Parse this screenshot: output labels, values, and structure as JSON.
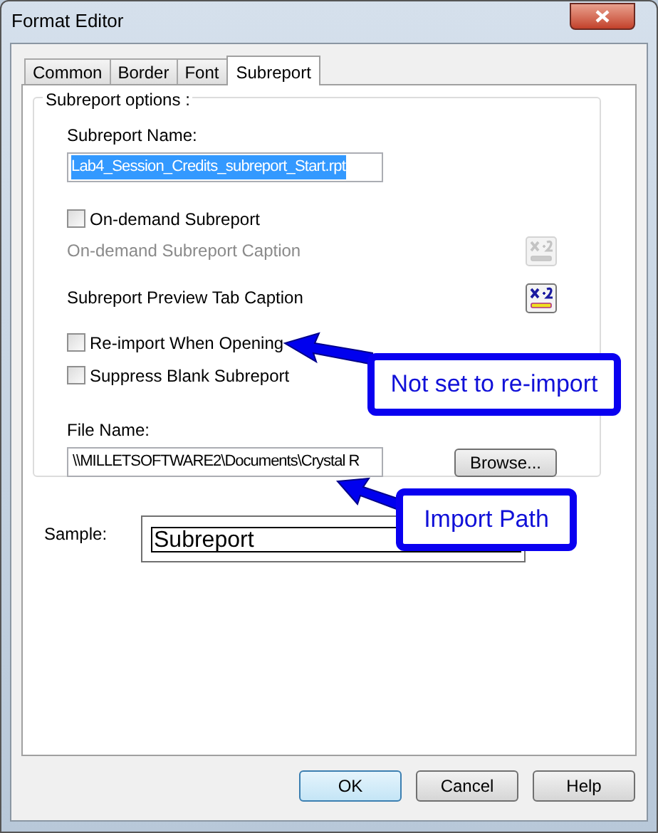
{
  "window": {
    "title": "Format Editor"
  },
  "tabs": [
    {
      "label": "Common",
      "selected": false
    },
    {
      "label": "Border",
      "selected": false
    },
    {
      "label": "Font",
      "selected": false
    },
    {
      "label": "Subreport",
      "selected": true
    }
  ],
  "group": {
    "title": "Subreport options :",
    "subreport_name": {
      "label": "Subreport Name:",
      "value": "Lab4_Session_Credits_subreport_Start.rpt",
      "selected": true
    },
    "rows": [
      {
        "kind": "checkbox",
        "label": "On-demand Subreport",
        "checked": false
      },
      {
        "kind": "formula",
        "label": "On-demand Subreport Caption",
        "disabled": true
      },
      {
        "kind": "formula",
        "label": "Subreport Preview Tab Caption",
        "disabled": false
      },
      {
        "kind": "checkbox",
        "label": "Re-import When Opening",
        "checked": false
      },
      {
        "kind": "checkbox",
        "label": "Suppress Blank Subreport",
        "checked": false
      }
    ],
    "file_name": {
      "label": "File Name:",
      "value": "\\\\MILLETSOFTWARE2\\Documents\\Crystal R",
      "button": "Browse..."
    }
  },
  "sample": {
    "label": "Sample:",
    "text": "Subreport"
  },
  "buttons": [
    {
      "label": "OK",
      "default": true
    },
    {
      "label": "Cancel",
      "default": false
    },
    {
      "label": "Help",
      "default": false
    }
  ],
  "callouts": [
    {
      "text": "Not set to re-import"
    },
    {
      "text": "Import Path"
    }
  ]
}
